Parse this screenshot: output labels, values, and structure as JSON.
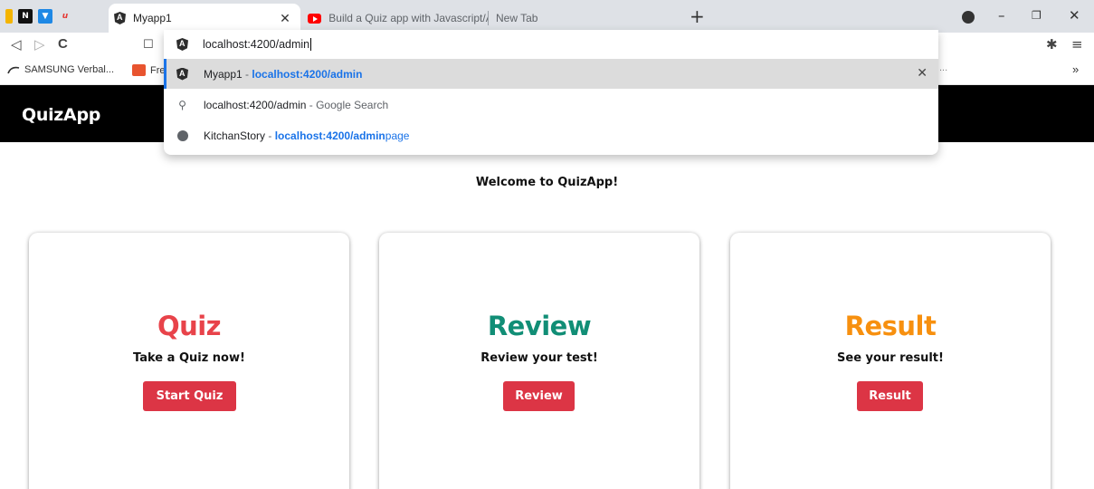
{
  "browser": {
    "tabs": [
      {
        "title": "Myapp1",
        "active": true
      },
      {
        "title": "Build a Quiz app with Javascript/Angu",
        "active": false
      },
      {
        "title": "New Tab",
        "active": false
      }
    ],
    "tab_close_glyph": "✕",
    "new_tab_glyph": "+",
    "window_controls": {
      "minimize": "–",
      "restore": "❐",
      "close": "✕"
    },
    "nav": {
      "back": "◁",
      "forward": "▷",
      "reload": "C",
      "bookmark": "☐"
    },
    "extensions_glyph": "✱",
    "menu_glyph": "≡",
    "bookmarks": [
      {
        "label": "SAMSUNG Verbal..."
      },
      {
        "label": "Fre"
      }
    ],
    "bookmarks_more": "»",
    "bookmarks_overflow": "..."
  },
  "omnibox": {
    "value": "localhost:4200/admin",
    "suggestions": [
      {
        "title": "Myapp1",
        "sep": " - ",
        "url": "localhost:4200/admin",
        "url_tail": "",
        "icon": "angular-icon",
        "selected": true,
        "remove": "✕"
      },
      {
        "title": "localhost:4200/admin",
        "sep": "",
        "detail": " - Google Search",
        "icon": "search-icon",
        "selected": false
      },
      {
        "title": "KitchanStory",
        "sep": " - ",
        "url": "localhost:4200/admin",
        "url_tail": "page",
        "icon": "globe-icon",
        "selected": false
      }
    ]
  },
  "app": {
    "brand": "QuizApp",
    "welcome": "Welcome to QuizApp!",
    "cards": [
      {
        "title": "Quiz",
        "subtitle": "Take a Quiz now!",
        "button": "Start Quiz",
        "color": "#e8434a"
      },
      {
        "title": "Review",
        "subtitle": "Review your test!",
        "button": "Review",
        "color": "#118e76"
      },
      {
        "title": "Result",
        "subtitle": "See your result!",
        "button": "Result",
        "color": "#f7900f"
      }
    ]
  },
  "colors": {
    "button": "#dc3545",
    "header": "#000000",
    "link": "#1a73e8"
  }
}
